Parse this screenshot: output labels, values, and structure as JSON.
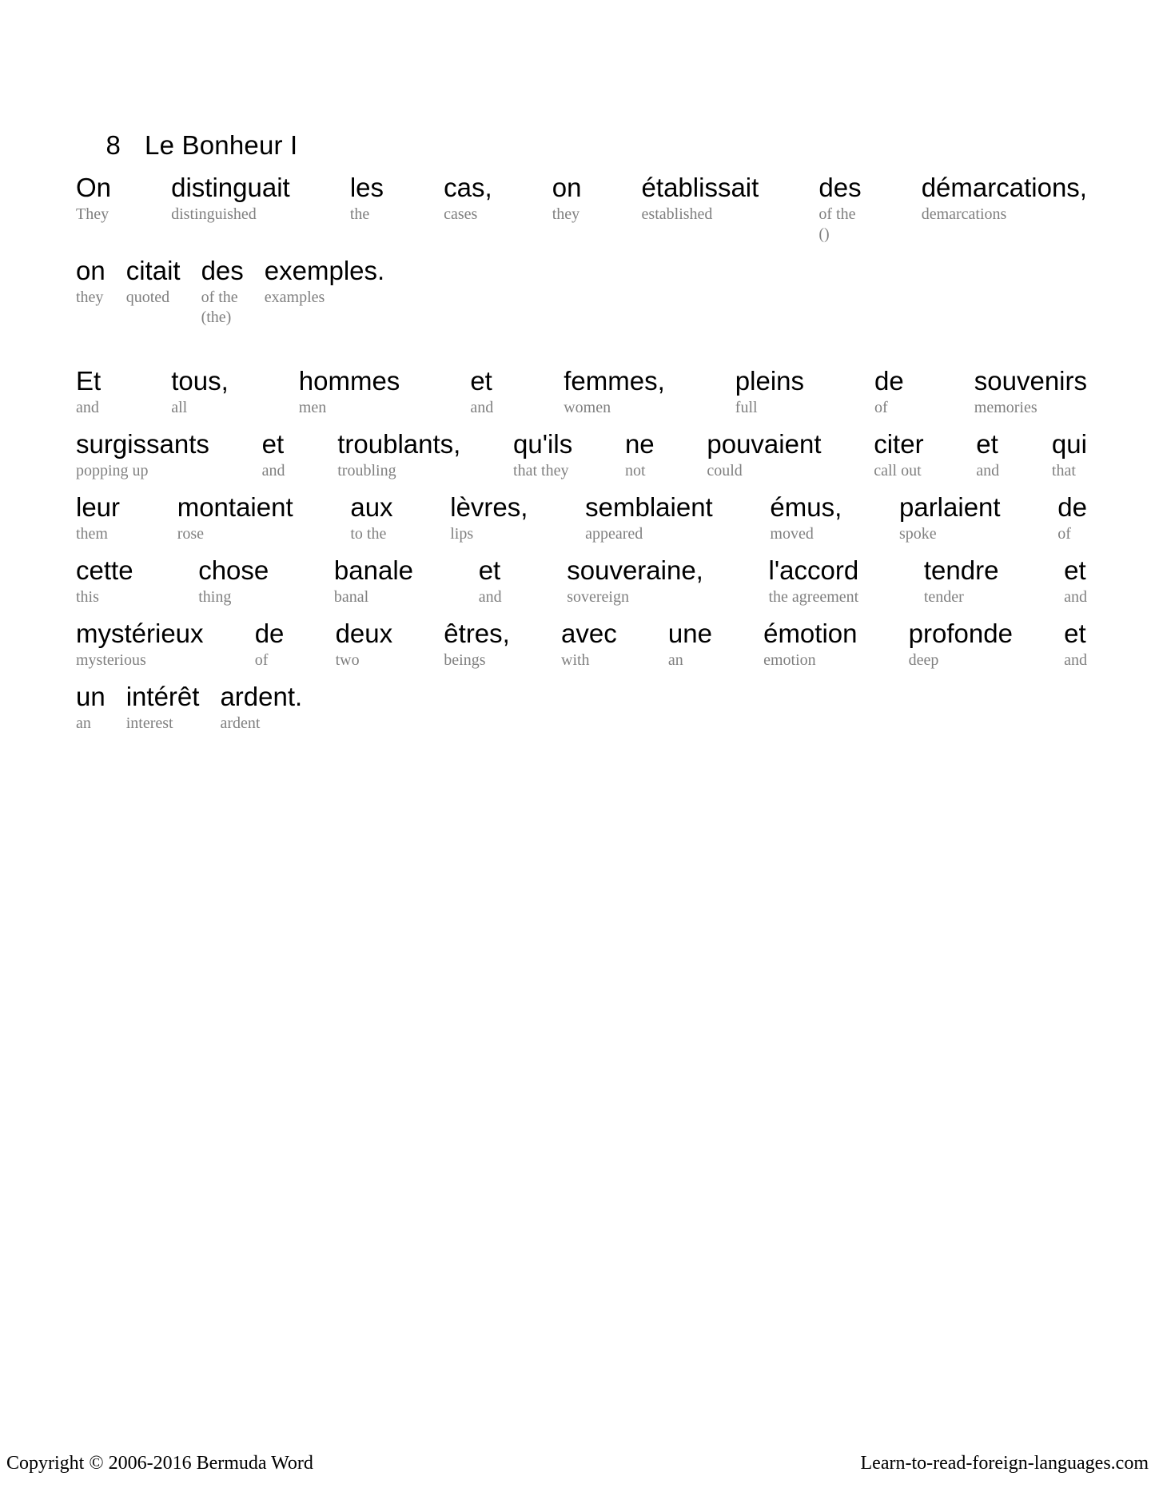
{
  "heading": {
    "number": "8",
    "title": "Le Bonheur I"
  },
  "footer": {
    "copyright": "Copyright © 2006-2016 Bermuda Word",
    "site": "Learn-to-read-foreign-languages.com"
  },
  "paragraphs": [
    {
      "id": "para-1",
      "lines": [
        {
          "id": "line-1-1",
          "spread": true,
          "pairs": [
            {
              "src": "On",
              "gloss": "They",
              "gloss2": ""
            },
            {
              "src": "distinguait",
              "gloss": "distinguished",
              "gloss2": ""
            },
            {
              "src": "les",
              "gloss": "the",
              "gloss2": ""
            },
            {
              "src": "cas,",
              "gloss": "cases",
              "gloss2": ""
            },
            {
              "src": "on",
              "gloss": "they",
              "gloss2": ""
            },
            {
              "src": "établissait",
              "gloss": "established",
              "gloss2": ""
            },
            {
              "src": "des",
              "gloss": "of the",
              "gloss2": "()"
            },
            {
              "src": "démarcations,",
              "gloss": "demarcations",
              "gloss2": ""
            }
          ]
        },
        {
          "id": "line-1-2",
          "spread": false,
          "pairs": [
            {
              "src": "on",
              "gloss": "they",
              "gloss2": ""
            },
            {
              "src": "citait",
              "gloss": "quoted",
              "gloss2": ""
            },
            {
              "src": "des",
              "gloss": "of the",
              "gloss2": "(the)"
            },
            {
              "src": "exemples.",
              "gloss": "examples",
              "gloss2": ""
            }
          ]
        }
      ]
    },
    {
      "id": "para-2",
      "lines": [
        {
          "id": "line-2-1",
          "spread": true,
          "pairs": [
            {
              "src": "Et",
              "gloss": "and",
              "gloss2": ""
            },
            {
              "src": "tous,",
              "gloss": "all",
              "gloss2": ""
            },
            {
              "src": "hommes",
              "gloss": "men",
              "gloss2": ""
            },
            {
              "src": "et",
              "gloss": "and",
              "gloss2": ""
            },
            {
              "src": "femmes,",
              "gloss": "women",
              "gloss2": ""
            },
            {
              "src": "pleins",
              "gloss": "full",
              "gloss2": ""
            },
            {
              "src": "de",
              "gloss": "of",
              "gloss2": ""
            },
            {
              "src": "souvenirs",
              "gloss": "memories",
              "gloss2": ""
            }
          ]
        },
        {
          "id": "line-2-2",
          "spread": true,
          "pairs": [
            {
              "src": "surgissants",
              "gloss": "popping up",
              "gloss2": ""
            },
            {
              "src": "et",
              "gloss": "and",
              "gloss2": ""
            },
            {
              "src": "troublants,",
              "gloss": "troubling",
              "gloss2": ""
            },
            {
              "src": "qu'ils",
              "gloss": "that they",
              "gloss2": ""
            },
            {
              "src": "ne",
              "gloss": "not",
              "gloss2": ""
            },
            {
              "src": "pouvaient",
              "gloss": "could",
              "gloss2": ""
            },
            {
              "src": "citer",
              "gloss": "call out",
              "gloss2": ""
            },
            {
              "src": "et",
              "gloss": "and",
              "gloss2": ""
            },
            {
              "src": "qui",
              "gloss": "that",
              "gloss2": ""
            }
          ]
        },
        {
          "id": "line-2-3",
          "spread": true,
          "pairs": [
            {
              "src": "leur",
              "gloss": "them",
              "gloss2": ""
            },
            {
              "src": "montaient",
              "gloss": "rose",
              "gloss2": ""
            },
            {
              "src": "aux",
              "gloss": "to the",
              "gloss2": ""
            },
            {
              "src": "lèvres,",
              "gloss": "lips",
              "gloss2": ""
            },
            {
              "src": "semblaient",
              "gloss": "appeared",
              "gloss2": ""
            },
            {
              "src": "émus,",
              "gloss": "moved",
              "gloss2": ""
            },
            {
              "src": "parlaient",
              "gloss": "spoke",
              "gloss2": ""
            },
            {
              "src": "de",
              "gloss": "of",
              "gloss2": ""
            }
          ]
        },
        {
          "id": "line-2-4",
          "spread": true,
          "pairs": [
            {
              "src": "cette",
              "gloss": "this",
              "gloss2": ""
            },
            {
              "src": "chose",
              "gloss": "thing",
              "gloss2": ""
            },
            {
              "src": "banale",
              "gloss": "banal",
              "gloss2": ""
            },
            {
              "src": "et",
              "gloss": "and",
              "gloss2": ""
            },
            {
              "src": "souveraine,",
              "gloss": "sovereign",
              "gloss2": ""
            },
            {
              "src": "l'accord",
              "gloss": "the agreement",
              "gloss2": ""
            },
            {
              "src": "tendre",
              "gloss": "tender",
              "gloss2": ""
            },
            {
              "src": "et",
              "gloss": "and",
              "gloss2": ""
            }
          ]
        },
        {
          "id": "line-2-5",
          "spread": true,
          "pairs": [
            {
              "src": "mystérieux",
              "gloss": "mysterious",
              "gloss2": ""
            },
            {
              "src": "de",
              "gloss": "of",
              "gloss2": ""
            },
            {
              "src": "deux",
              "gloss": "two",
              "gloss2": ""
            },
            {
              "src": "êtres,",
              "gloss": "beings",
              "gloss2": ""
            },
            {
              "src": "avec",
              "gloss": "with",
              "gloss2": ""
            },
            {
              "src": "une",
              "gloss": "an",
              "gloss2": ""
            },
            {
              "src": "émotion",
              "gloss": "emotion",
              "gloss2": ""
            },
            {
              "src": "profonde",
              "gloss": "deep",
              "gloss2": ""
            },
            {
              "src": "et",
              "gloss": "and",
              "gloss2": ""
            }
          ]
        },
        {
          "id": "line-2-6",
          "spread": false,
          "pairs": [
            {
              "src": "un",
              "gloss": "an",
              "gloss2": ""
            },
            {
              "src": "intérêt",
              "gloss": "interest",
              "gloss2": ""
            },
            {
              "src": "ardent.",
              "gloss": "ardent",
              "gloss2": ""
            }
          ]
        }
      ]
    }
  ]
}
